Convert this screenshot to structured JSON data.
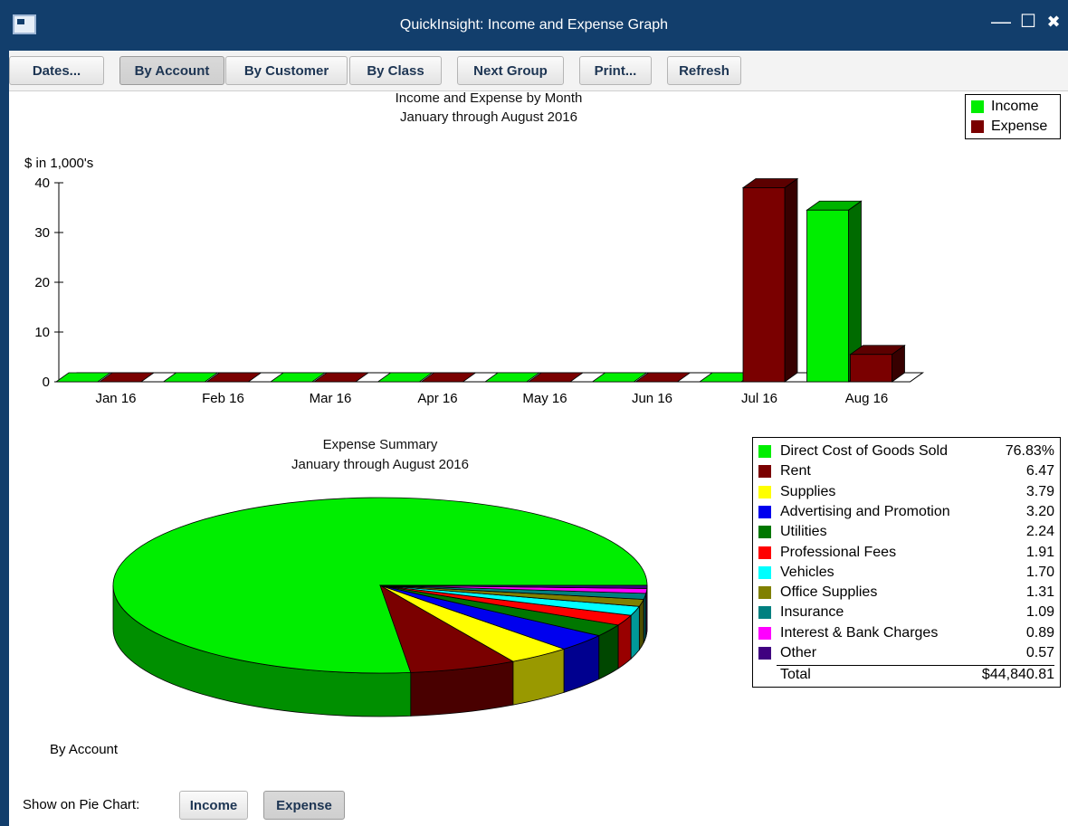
{
  "window": {
    "title": "QuickInsight: Income and Expense Graph",
    "minimize": "—",
    "maximize": "☐",
    "close": "✖"
  },
  "toolbar": {
    "buttons": [
      {
        "label": "Dates...",
        "active": false
      },
      {
        "label": "By Account",
        "active": true
      },
      {
        "label": "By Customer",
        "active": false
      },
      {
        "label": "By Class",
        "active": false
      },
      {
        "label": "Next Group",
        "active": false
      },
      {
        "label": "Print...",
        "active": false
      },
      {
        "label": "Refresh",
        "active": false
      }
    ]
  },
  "chart_data": [
    {
      "type": "bar",
      "title": "Income and Expense by Month",
      "subtitle": "January through August 2016",
      "ylabel": "$ in 1,000's",
      "ylim": [
        0,
        40
      ],
      "yticks": [
        "0",
        "10",
        "20",
        "30",
        "40"
      ],
      "categories": [
        "Jan 16",
        "Feb 16",
        "Mar 16",
        "Apr 16",
        "May 16",
        "Jun 16",
        "Jul 16",
        "Aug 16"
      ],
      "legend_position": "top-right",
      "series": [
        {
          "name": "Income",
          "color": "#00ee00",
          "values": [
            0,
            0,
            0,
            0,
            0,
            0,
            0,
            34.5
          ]
        },
        {
          "name": "Expense",
          "color": "#7a0000",
          "values": [
            0,
            0,
            0,
            0,
            0,
            0,
            39,
            5.5
          ]
        }
      ]
    },
    {
      "type": "pie",
      "title": "Expense Summary",
      "subtitle": "January through August 2016",
      "slices": [
        {
          "label": "Direct Cost of Goods Sold",
          "value": "76.83%",
          "pct": 76.83,
          "color": "#00ee00"
        },
        {
          "label": "Rent",
          "value": "6.47",
          "pct": 6.47,
          "color": "#7a0000"
        },
        {
          "label": "Supplies",
          "value": "3.79",
          "pct": 3.79,
          "color": "#ffff00"
        },
        {
          "label": "Advertising and Promotion",
          "value": "3.20",
          "pct": 3.2,
          "color": "#0000ee"
        },
        {
          "label": "Utilities",
          "value": "2.24",
          "pct": 2.24,
          "color": "#007700"
        },
        {
          "label": "Professional Fees",
          "value": "1.91",
          "pct": 1.91,
          "color": "#ff0000"
        },
        {
          "label": "Vehicles",
          "value": "1.70",
          "pct": 1.7,
          "color": "#00ffff"
        },
        {
          "label": "Office Supplies",
          "value": "1.31",
          "pct": 1.31,
          "color": "#808000"
        },
        {
          "label": "Insurance",
          "value": "1.09",
          "pct": 1.09,
          "color": "#008080"
        },
        {
          "label": "Interest & Bank Charges",
          "value": "0.89",
          "pct": 0.89,
          "color": "#ff00ff"
        },
        {
          "label": "Other",
          "value": "0.57",
          "pct": 0.57,
          "color": "#400080"
        }
      ],
      "total_label": "Total",
      "total_value": "$44,840.81"
    }
  ],
  "group_label": "By Account",
  "pie_toggle": {
    "label": "Show on Pie Chart:",
    "income": "Income",
    "expense": "Expense",
    "selected": "Expense"
  }
}
